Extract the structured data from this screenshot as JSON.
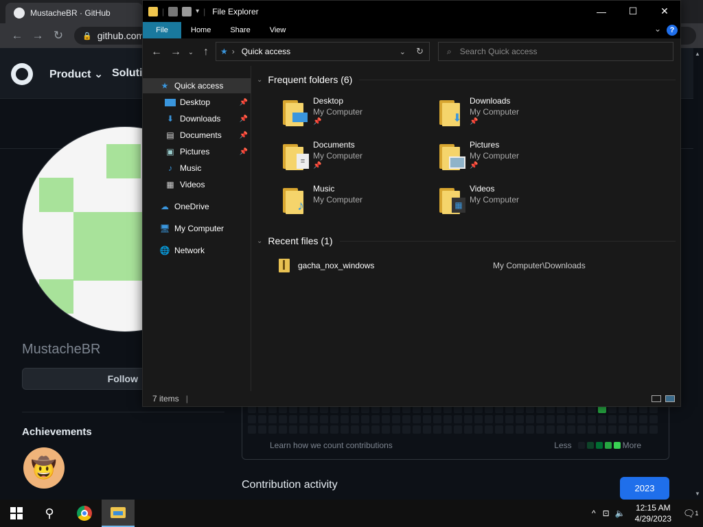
{
  "browser": {
    "tab_title": "MustacheBR · GitHub",
    "url": "github.com"
  },
  "github": {
    "nav": [
      "Product",
      "Solutio"
    ],
    "username": "MustacheBR",
    "follow_label": "Follow",
    "achievements_title": "Achievements",
    "contrib_learn": "Learn how we count contributions",
    "legend_less": "Less",
    "legend_more": "More",
    "contrib_activity": "Contribution activity",
    "year": "2023"
  },
  "explorer": {
    "title": "File Explorer",
    "ribbon_tabs": [
      "File",
      "Home",
      "Share",
      "View"
    ],
    "address": "Quick access",
    "search_placeholder": "Search Quick access",
    "nav_items": [
      {
        "label": "Quick access",
        "icon": "star-icon",
        "selected": true
      },
      {
        "label": "Desktop",
        "icon": "desktop-icon",
        "pinned": true
      },
      {
        "label": "Downloads",
        "icon": "download-icon",
        "pinned": true
      },
      {
        "label": "Documents",
        "icon": "document-icon",
        "pinned": true
      },
      {
        "label": "Pictures",
        "icon": "picture-icon",
        "pinned": true
      },
      {
        "label": "Music",
        "icon": "music-icon"
      },
      {
        "label": "Videos",
        "icon": "video-icon"
      },
      {
        "label": "OneDrive",
        "icon": "cloud-icon"
      },
      {
        "label": "My Computer",
        "icon": "computer-icon"
      },
      {
        "label": "Network",
        "icon": "network-icon"
      }
    ],
    "frequent_header": "Frequent folders (6)",
    "folders": [
      {
        "name": "Desktop",
        "location": "My Computer",
        "pinned": true,
        "icon": "desktop-icon"
      },
      {
        "name": "Downloads",
        "location": "My Computer",
        "pinned": true,
        "icon": "download-icon"
      },
      {
        "name": "Documents",
        "location": "My Computer",
        "pinned": true,
        "icon": "document-icon"
      },
      {
        "name": "Pictures",
        "location": "My Computer",
        "pinned": true,
        "icon": "picture-icon"
      },
      {
        "name": "Music",
        "location": "My Computer",
        "pinned": false,
        "icon": "music-icon"
      },
      {
        "name": "Videos",
        "location": "My Computer",
        "pinned": false,
        "icon": "video-icon"
      }
    ],
    "recent_header": "Recent files (1)",
    "recent_files": [
      {
        "name": "gacha_nox_windows",
        "location": "My Computer\\Downloads"
      }
    ],
    "status": "7 items"
  },
  "taskbar": {
    "time": "12:15 AM",
    "date": "4/29/2023",
    "notifications": "1"
  },
  "colors": {
    "ribbon_file": "#19799e",
    "accent": "#1f6feb",
    "contribution_green": "#26a641"
  }
}
